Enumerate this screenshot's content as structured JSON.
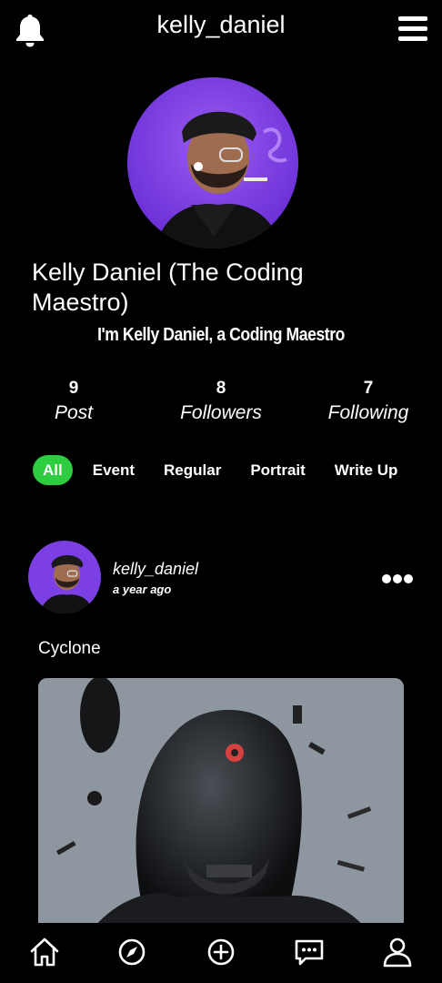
{
  "header": {
    "username": "kelly_daniel",
    "left_icon": "bell-icon",
    "right_icon": "menu-icon"
  },
  "profile": {
    "full_name": "Kelly Daniel (The Coding Maestro)",
    "bio": "I'm Kelly Daniel, a Coding Maestro",
    "stats": [
      {
        "value": "9",
        "label": "Post"
      },
      {
        "value": "8",
        "label": "Followers"
      },
      {
        "value": "7",
        "label": "Following"
      }
    ]
  },
  "filters": {
    "items": [
      "All",
      "Event",
      "Regular",
      "Portrait",
      "Write Up"
    ],
    "active": "All",
    "active_color": "#2ecc40"
  },
  "post": {
    "username": "kelly_daniel",
    "time": "a year ago",
    "caption": "Cyclone",
    "more_icon": "more-dots-icon"
  },
  "bottom_nav": {
    "items": [
      "home-icon",
      "explore-compass-icon",
      "add-post-icon",
      "messages-icon",
      "profile-icon"
    ]
  },
  "colors": {
    "background": "#000000",
    "text": "#ffffff",
    "accent": "#2ecc40",
    "avatar_bg": "#7b3fe4"
  }
}
